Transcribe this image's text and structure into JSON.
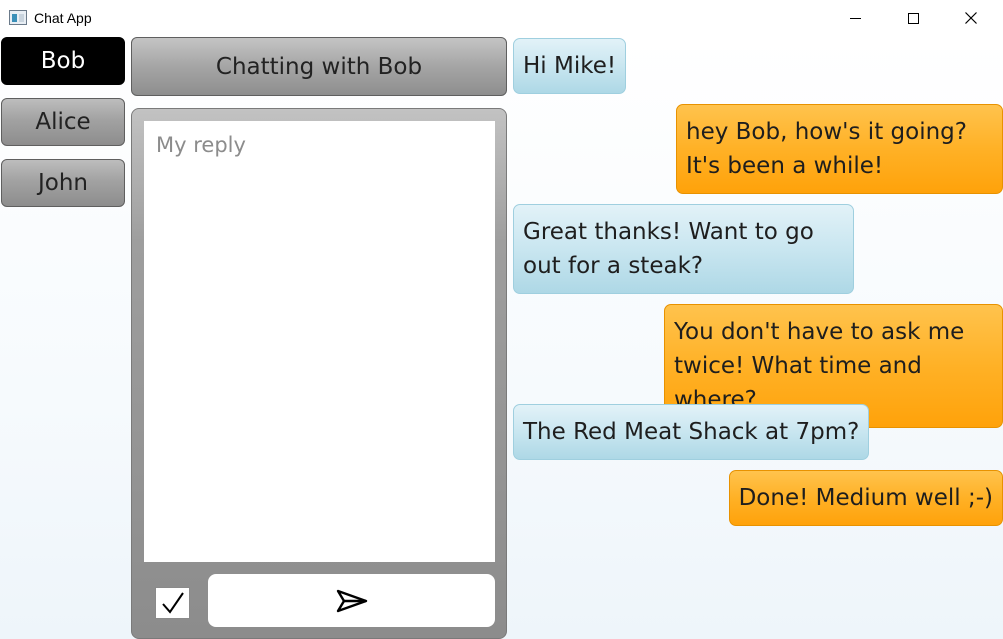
{
  "window": {
    "title": "Chat App"
  },
  "contacts": [
    {
      "name": "Bob",
      "active": true
    },
    {
      "name": "Alice",
      "active": false
    },
    {
      "name": "John",
      "active": false
    }
  ],
  "chat": {
    "header": "Chatting with Bob"
  },
  "reply": {
    "placeholder": "My reply",
    "value": "",
    "checkbox_checked": true
  },
  "messages": [
    {
      "direction": "in",
      "text": "Hi Mike!"
    },
    {
      "direction": "out",
      "text": "hey Bob, how's it going? It's been a while!"
    },
    {
      "direction": "in",
      "text": "Great thanks! Want to go out for a steak?"
    },
    {
      "direction": "out",
      "text": "You don't have to ask me twice! What time and where?"
    },
    {
      "direction": "in",
      "text": "The Red Meat Shack at 7pm?"
    },
    {
      "direction": "out",
      "text": "Done! Medium well ;-)"
    }
  ],
  "icons": {
    "app": "app-window-icon",
    "minimize": "minimize-icon",
    "maximize": "maximize-icon",
    "close": "close-icon",
    "check": "checkmark-icon",
    "send": "send-icon"
  },
  "colors": {
    "incoming_bubble": "#c9e6f0",
    "outgoing_bubble": "#ffb126",
    "active_contact": "#000000",
    "inactive_contact": "#a2a2a2"
  }
}
